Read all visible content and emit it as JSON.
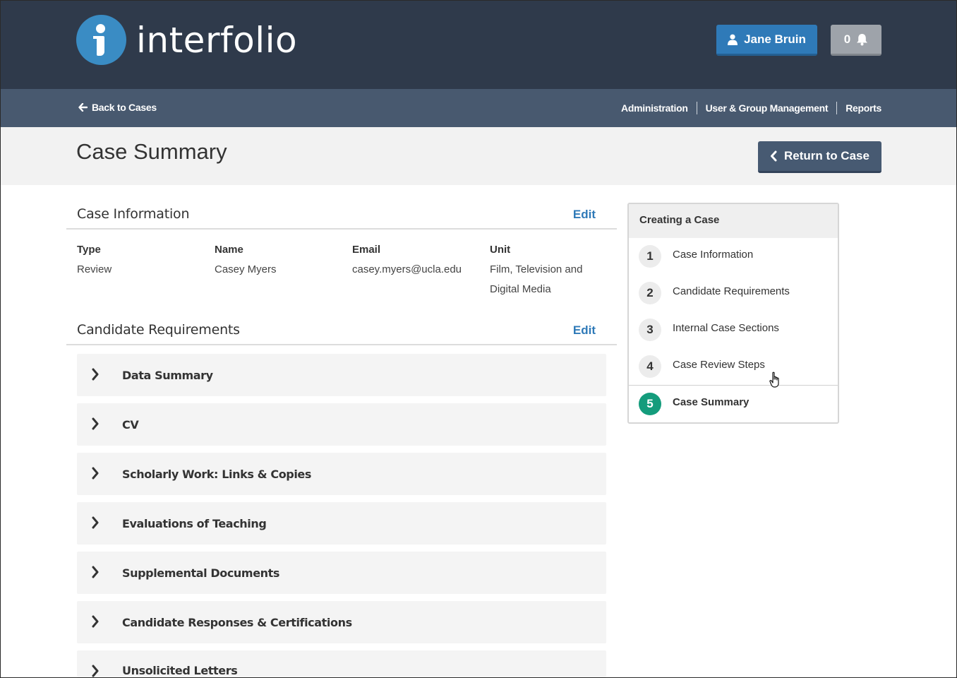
{
  "brand": {
    "name": "interfolio"
  },
  "header": {
    "user_name": "Jane Bruin",
    "notification_count": "0"
  },
  "nav": {
    "back_label": "Back to Cases",
    "links": [
      "Administration",
      "User & Group Management",
      "Reports"
    ]
  },
  "page": {
    "title": "Case Summary",
    "return_label": "Return to Case"
  },
  "case_information": {
    "title": "Case Information",
    "edit_label": "Edit",
    "fields": [
      {
        "label": "Type",
        "value": "Review"
      },
      {
        "label": "Name",
        "value": "Casey Myers"
      },
      {
        "label": "Email",
        "value": "casey.myers@ucla.edu"
      },
      {
        "label": "Unit",
        "value": "Film, Television and Digital Media"
      }
    ]
  },
  "candidate_requirements": {
    "title": "Candidate Requirements",
    "edit_label": "Edit",
    "items": [
      "Data Summary",
      "CV",
      "Scholarly Work: Links & Copies",
      "Evaluations of Teaching",
      "Supplemental Documents",
      "Candidate Responses & Certifications",
      "Unsolicited Letters"
    ]
  },
  "steps_panel": {
    "title": "Creating a Case",
    "steps": [
      {
        "num": "1",
        "label": "Case Information"
      },
      {
        "num": "2",
        "label": "Candidate Requirements"
      },
      {
        "num": "3",
        "label": "Internal Case Sections"
      },
      {
        "num": "4",
        "label": "Case Review Steps"
      },
      {
        "num": "5",
        "label": "Case Summary"
      }
    ],
    "active_step": "5"
  },
  "colors": {
    "header_bg": "#2f3a4b",
    "nav_bg": "#48596f",
    "primary_blue": "#2f7ab8",
    "active_step": "#149c7c"
  }
}
